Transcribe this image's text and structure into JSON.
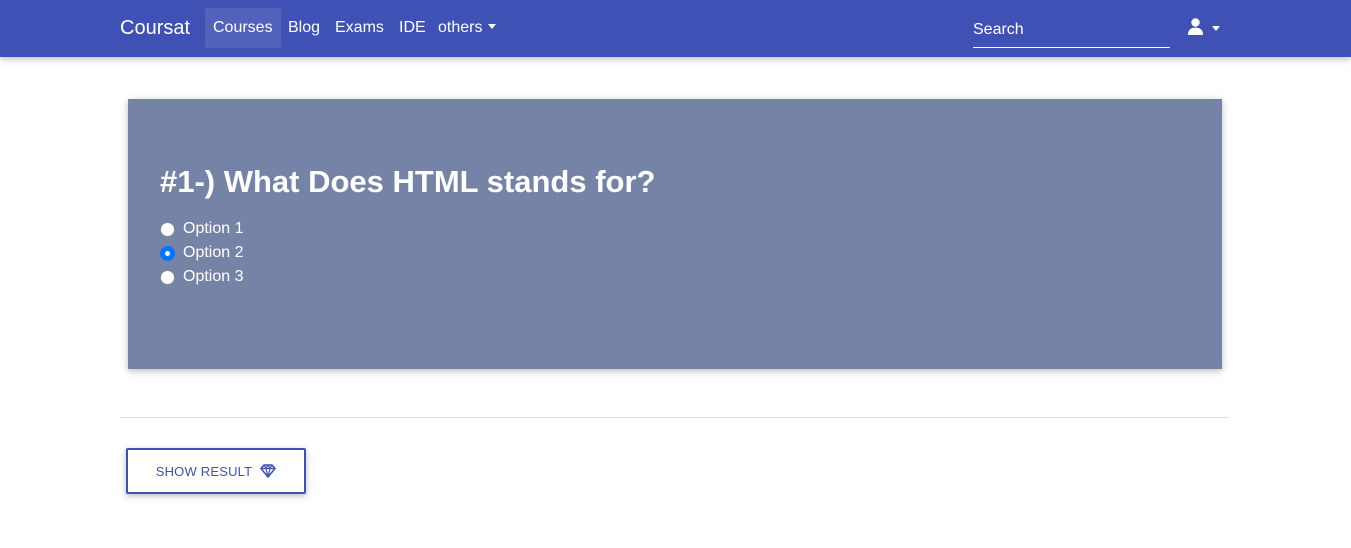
{
  "navbar": {
    "brand": "Coursat",
    "links": [
      {
        "label": "Courses",
        "active": true
      },
      {
        "label": "Blog",
        "active": false
      },
      {
        "label": "Exams",
        "active": false
      },
      {
        "label": "IDE",
        "active": false
      },
      {
        "label": "others",
        "active": false,
        "dropdown": true
      }
    ],
    "search": {
      "placeholder": "Search",
      "value": ""
    },
    "user_menu": {
      "icon": "user-icon",
      "dropdown": true
    }
  },
  "quiz": {
    "question": "#1-) What Does HTML stands for?",
    "options": [
      {
        "label": "Option 1",
        "checked": false
      },
      {
        "label": "Option 2",
        "checked": true
      },
      {
        "label": "Option 3",
        "checked": false
      }
    ]
  },
  "actions": {
    "show_result_label": "SHOW RESULT",
    "show_result_icon": "gem-icon"
  },
  "colors": {
    "primary": "#3f51b5",
    "card_background": "#7483a6",
    "radio_checked": "#0075ff"
  }
}
